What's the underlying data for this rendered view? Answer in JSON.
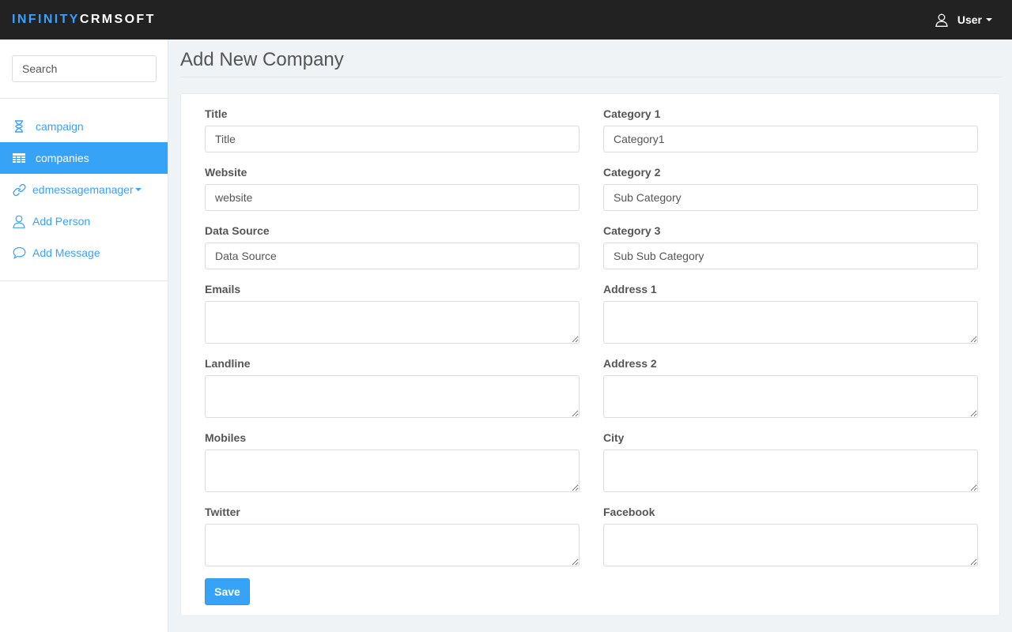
{
  "brand": {
    "part1": "INFINITY",
    "part2": "CRMSOFT"
  },
  "navbar": {
    "user_label": "User",
    "user_icon": "user-icon"
  },
  "sidebar": {
    "search_placeholder": "Search",
    "items": [
      {
        "label": "campaign",
        "icon": "hourglass-icon",
        "active": false
      },
      {
        "label": "companies",
        "icon": "table-icon",
        "active": true
      },
      {
        "label": "edmessagemanager",
        "icon": "link-icon",
        "active": false,
        "dropdown": true
      },
      {
        "label": "Add Person",
        "icon": "user-icon",
        "active": false
      },
      {
        "label": "Add Message",
        "icon": "speech-bubble-icon",
        "active": false
      }
    ]
  },
  "page": {
    "title": "Add New Company"
  },
  "form": {
    "left": [
      {
        "label": "Title",
        "type": "input",
        "placeholder": "Title"
      },
      {
        "label": "Website",
        "type": "input",
        "placeholder": "website"
      },
      {
        "label": "Data Source",
        "type": "input",
        "placeholder": "Data Source"
      },
      {
        "label": "Emails",
        "type": "textarea"
      },
      {
        "label": "Landline",
        "type": "textarea"
      },
      {
        "label": "Mobiles",
        "type": "textarea"
      },
      {
        "label": "Twitter",
        "type": "textarea"
      }
    ],
    "right": [
      {
        "label": "Category 1",
        "type": "input",
        "placeholder": "Category1"
      },
      {
        "label": "Category 2",
        "type": "input",
        "placeholder": "Sub Category"
      },
      {
        "label": "Category 3",
        "type": "input",
        "placeholder": "Sub Sub Category"
      },
      {
        "label": "Address 1",
        "type": "textarea"
      },
      {
        "label": "Address 2",
        "type": "textarea"
      },
      {
        "label": "City",
        "type": "textarea"
      },
      {
        "label": "Facebook",
        "type": "textarea"
      }
    ],
    "save_label": "Save"
  },
  "colors": {
    "accent": "#36a3f7",
    "navbar": "#222222",
    "brand_blue": "#3aa0ff"
  }
}
